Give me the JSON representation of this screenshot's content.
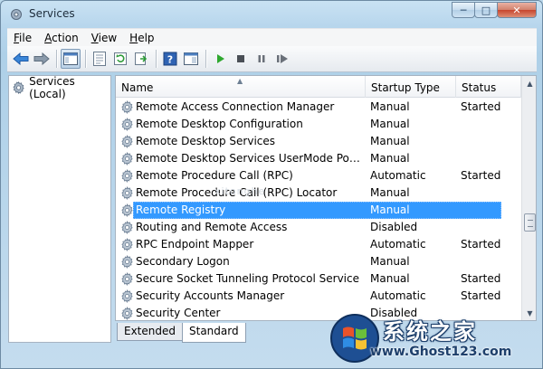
{
  "window": {
    "title": "Services"
  },
  "menu": [
    {
      "label": "File",
      "key": "F",
      "rest": "ile"
    },
    {
      "label": "Action",
      "key": "A",
      "rest": "ction"
    },
    {
      "label": "View",
      "key": "V",
      "rest": "iew"
    },
    {
      "label": "Help",
      "key": "H",
      "rest": "elp"
    }
  ],
  "toolbar": [
    "back-arrow-icon",
    "forward-arrow-icon",
    "show-hide-console-tree-icon",
    "properties-icon",
    "refresh-icon",
    "export-list-icon",
    "help-icon",
    "console-view-icon",
    "start-service-icon",
    "stop-service-icon",
    "pause-service-icon",
    "restart-service-icon"
  ],
  "tree": {
    "root": "Services (Local)"
  },
  "columns": {
    "name": "Name",
    "startup": "Startup Type",
    "status": "Status"
  },
  "rows": [
    {
      "name": "Remote Access Connection Manager",
      "startup": "Manual",
      "status": "Started"
    },
    {
      "name": "Remote Desktop Configuration",
      "startup": "Manual",
      "status": ""
    },
    {
      "name": "Remote Desktop Services",
      "startup": "Manual",
      "status": ""
    },
    {
      "name": "Remote Desktop Services UserMode Port Redi...",
      "startup": "Manual",
      "status": ""
    },
    {
      "name": "Remote Procedure Call (RPC)",
      "startup": "Automatic",
      "status": "Started"
    },
    {
      "name": "Remote Procedure Call (RPC) Locator",
      "startup": "Manual",
      "status": ""
    },
    {
      "name": "Remote Registry",
      "startup": "Manual",
      "status": "",
      "selected": true
    },
    {
      "name": "Routing and Remote Access",
      "startup": "Disabled",
      "status": ""
    },
    {
      "name": "RPC Endpoint Mapper",
      "startup": "Automatic",
      "status": "Started"
    },
    {
      "name": "Secondary Logon",
      "startup": "Manual",
      "status": ""
    },
    {
      "name": "Secure Socket Tunneling Protocol Service",
      "startup": "Manual",
      "status": "Started"
    },
    {
      "name": "Security Accounts Manager",
      "startup": "Automatic",
      "status": "Started"
    },
    {
      "name": "Security Center",
      "startup": "Disabled",
      "status": ""
    }
  ],
  "tabs": [
    {
      "label": "Extended",
      "active": false
    },
    {
      "label": "Standard",
      "active": true
    }
  ],
  "watermark": {
    "brand": "系统之家",
    "url": "www.Ghost123.com",
    "faint": "xitonghe"
  },
  "colors": {
    "selection": "#3399ff",
    "title_gradient": "#b6d5ec",
    "play": "#2fa82f"
  }
}
